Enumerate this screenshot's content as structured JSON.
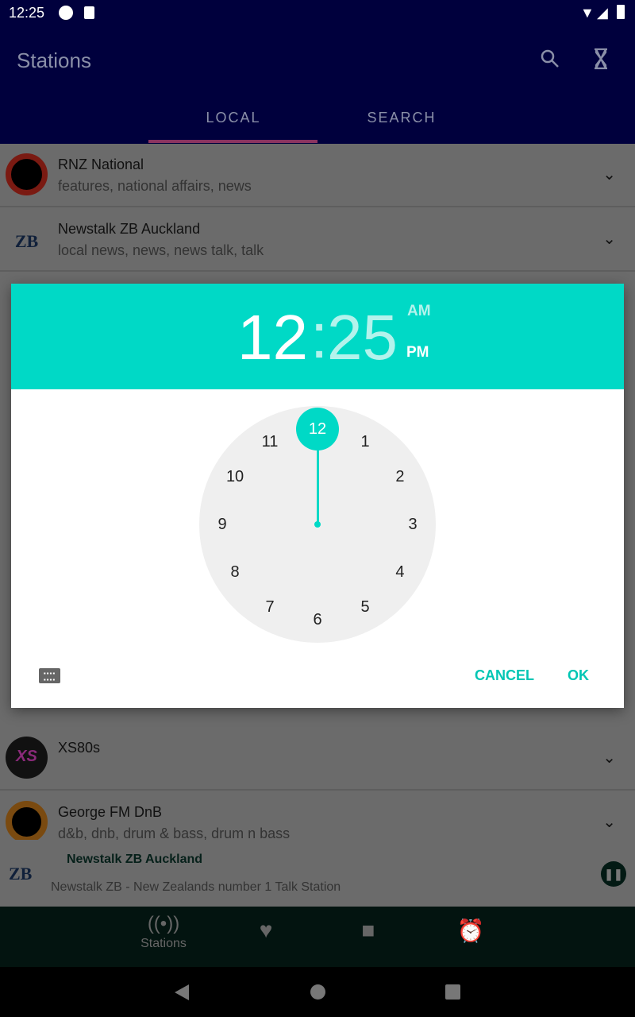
{
  "status": {
    "time": "12:25"
  },
  "appbar": {
    "title": "Stations"
  },
  "tabs": [
    {
      "label": "LOCAL",
      "selected": true
    },
    {
      "label": "SEARCH",
      "selected": false
    }
  ],
  "stations": [
    {
      "name": "RNZ National",
      "tags": "features, national affairs, news"
    },
    {
      "name": "Newstalk ZB Auckland",
      "tags": "local news, news, news talk, talk"
    },
    {
      "name": "XS80s",
      "tags": ""
    },
    {
      "name": "George FM DnB",
      "tags": "d&b, dnb, drum & bass, drum n bass"
    }
  ],
  "now_playing": {
    "title": "Newstalk ZB Auckland",
    "subtitle": "Newstalk ZB - New Zealands number 1 Talk Station",
    "logo_text": "ZB"
  },
  "bottom_nav": {
    "stations_label": "Stations"
  },
  "time_picker": {
    "hour": "12",
    "separator": ":",
    "minute": "25",
    "am": "AM",
    "pm": "PM",
    "selected_period": "PM",
    "selected_hour": 12,
    "dial": [
      "12",
      "1",
      "2",
      "3",
      "4",
      "5",
      "6",
      "7",
      "8",
      "9",
      "10",
      "11"
    ],
    "cancel": "CANCEL",
    "ok": "OK",
    "accent": "#00d9c6"
  }
}
